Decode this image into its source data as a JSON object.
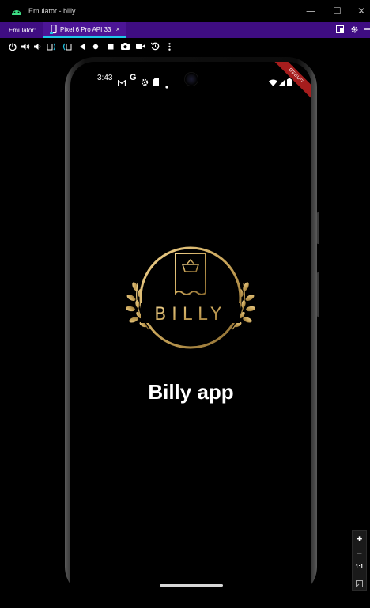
{
  "window": {
    "title": "Emulator - billy",
    "controls": {
      "minimize": "—",
      "maximize": "☐",
      "close": "✕"
    }
  },
  "tabbar": {
    "emulator_label": "Emulator:",
    "active_tab": {
      "label": "Pixel 6 Pro API 33",
      "close": "×"
    },
    "right_icons": [
      "snapshot-icon",
      "settings-icon",
      "minimize-panel-icon"
    ]
  },
  "toolbar": {
    "buttons": [
      "power-icon",
      "volume-up-icon",
      "volume-down-icon",
      "rotate-left-icon",
      "rotate-right-icon",
      "back-icon",
      "home-icon",
      "overview-icon",
      "screenshot-icon",
      "record-icon",
      "snapshot-restore-icon",
      "more-icon"
    ]
  },
  "device": {
    "status_bar": {
      "time": "3:43",
      "icons": [
        "gmail-icon",
        "google-icon",
        "settings-gear-icon",
        "sim-card-icon",
        "notification-dot-icon",
        "wifi-icon",
        "signal-icon",
        "battery-icon"
      ]
    },
    "debug_banner": "DEBUG",
    "logo": {
      "text": "BILLY"
    },
    "app_title": "Billy app"
  },
  "zoom_controls": {
    "zoom_in": "+",
    "zoom_out": "−",
    "one_to_one": "1:1"
  },
  "colors": {
    "tabbar_bg": "#3f0d82",
    "tab_active_underline": "#1fc6e8",
    "gold": "#c9a55a",
    "debug_banner": "#a61d1d",
    "screen_bg": "#000000"
  }
}
